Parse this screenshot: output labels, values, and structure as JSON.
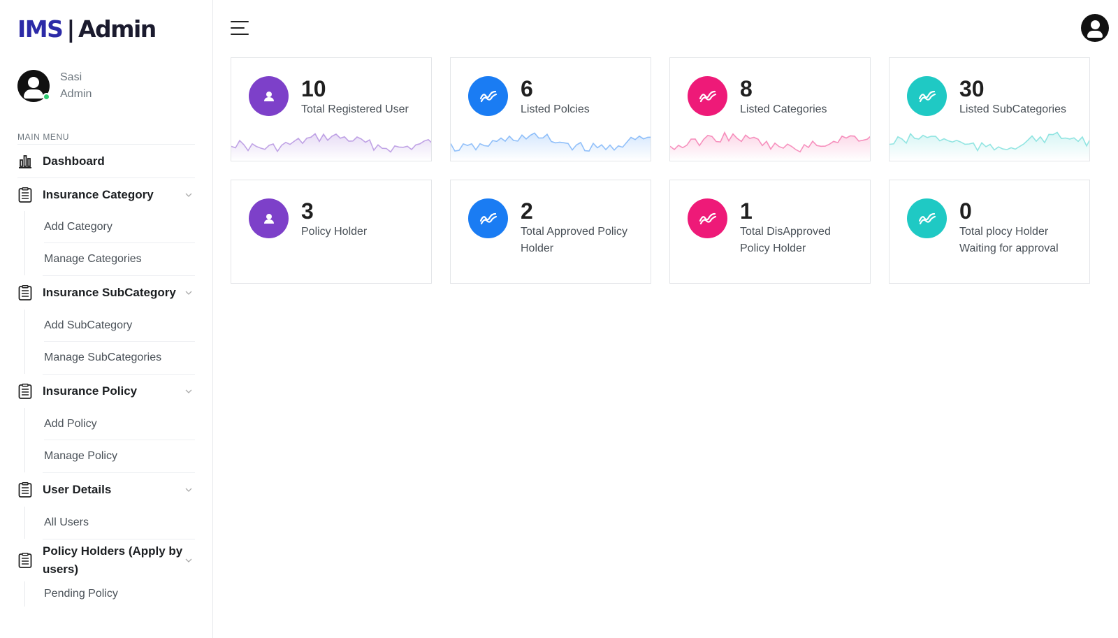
{
  "brand": {
    "part1": "IMS",
    "separator": "|",
    "part2": "Admin"
  },
  "user": {
    "name": "Sasi",
    "role": "Admin"
  },
  "sidebar": {
    "menu_title": "MAIN MENU",
    "dashboard": "Dashboard",
    "groups": [
      {
        "label": "Insurance Category",
        "items": [
          "Add Category",
          "Manage Categories"
        ]
      },
      {
        "label": "Insurance SubCategory",
        "items": [
          "Add SubCategory",
          "Manage SubCategories"
        ]
      },
      {
        "label": "Insurance Policy",
        "items": [
          "Add Policy",
          "Manage Policy"
        ]
      },
      {
        "label": "User Details",
        "items": [
          "All Users"
        ]
      },
      {
        "label": "Policy Holders (Apply by users)",
        "items": [
          "Pending Policy"
        ]
      }
    ]
  },
  "icons": {
    "menu": "hamburger-menu-icon",
    "profile": "user-avatar-icon",
    "dashboard": "bar-chart-icon",
    "group": "clipboard-list-icon",
    "chevron": "chevron-down-icon",
    "user_stat": "user-icon",
    "trend_stat": "trend-line-icon"
  },
  "colors": {
    "purple": "#7d40c9",
    "blue": "#1a7cf3",
    "pink": "#ee1a78",
    "teal": "#1fc9c4"
  },
  "stats": [
    {
      "value": "10",
      "label": "Total Registered User",
      "color": "purple",
      "icon": "user-icon"
    },
    {
      "value": "6",
      "label": "Listed Polcies",
      "color": "blue",
      "icon": "trend-line-icon"
    },
    {
      "value": "8",
      "label": "Listed Categories",
      "color": "pink",
      "icon": "trend-line-icon"
    },
    {
      "value": "30",
      "label": "Listed SubCategories",
      "color": "teal",
      "icon": "trend-line-icon"
    },
    {
      "value": "3",
      "label": "Policy Holder",
      "color": "purple",
      "icon": "user-icon"
    },
    {
      "value": "2",
      "label": "Total Approved Policy Holder",
      "color": "blue",
      "icon": "trend-line-icon"
    },
    {
      "value": "1",
      "label": "Total DisApproved Policy Holder",
      "color": "pink",
      "icon": "trend-line-icon"
    },
    {
      "value": "0",
      "label": "Total plocy Holder Waiting for approval",
      "color": "teal",
      "icon": "trend-line-icon"
    }
  ]
}
